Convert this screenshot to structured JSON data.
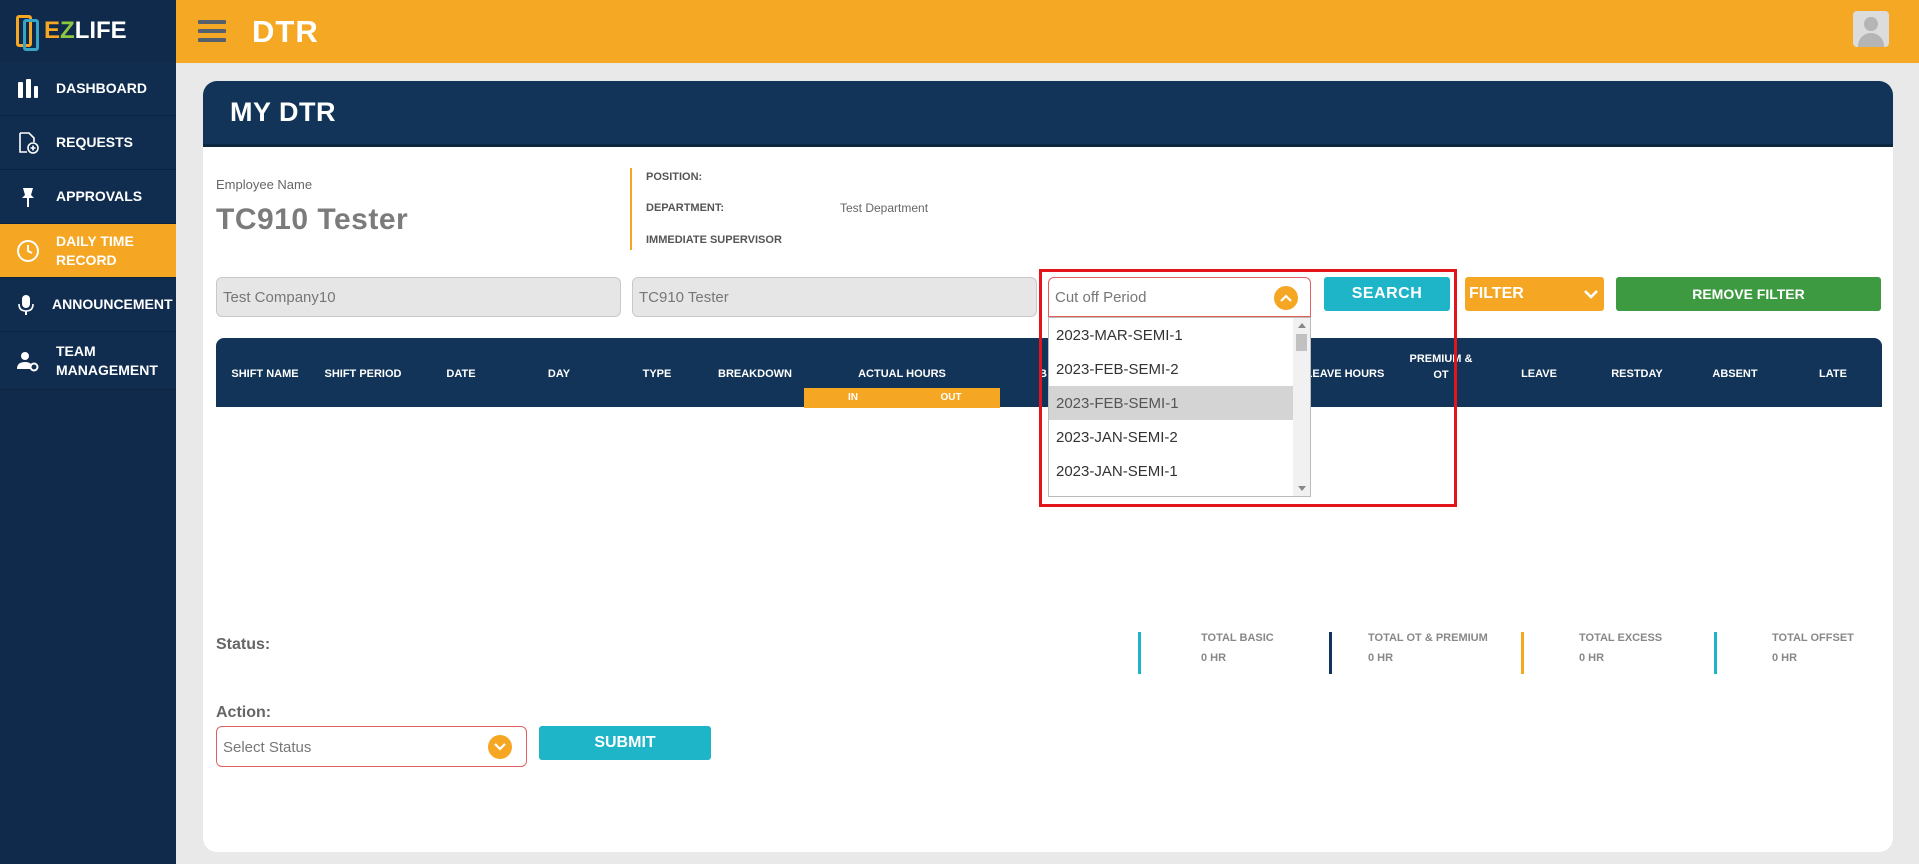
{
  "brand": {
    "logo_text_e": "E",
    "logo_text_z": "Z",
    "logo_text_rest": "LIFE"
  },
  "sidebar": {
    "items": [
      {
        "label": "DASHBOARD",
        "icon": "bar-chart-icon"
      },
      {
        "label": "REQUESTS",
        "icon": "document-add-icon"
      },
      {
        "label": "APPROVALS",
        "icon": "pin-icon"
      },
      {
        "label": "DAILY TIME RECORD",
        "icon": "clock-icon",
        "active": true
      },
      {
        "label": "ANNOUNCEMENT",
        "icon": "microphone-icon"
      },
      {
        "label": "TEAM MANAGEMENT",
        "icon": "user-gear-icon"
      }
    ]
  },
  "topbar": {
    "title": "DTR"
  },
  "page": {
    "title": "MY DTR",
    "employee_label": "Employee Name",
    "employee_name": "TC910 Tester",
    "position_label": "POSITION:",
    "position_value": "",
    "department_label": "DEPARTMENT:",
    "department_value": "Test Department",
    "supervisor_label": "IMMEDIATE SUPERVISOR",
    "supervisor_value": ""
  },
  "filters": {
    "company": "Test Company10",
    "employee": "TC910 Tester",
    "cutoff_placeholder": "Cut off Period",
    "cutoff_options": [
      "2023-MAR-SEMI-1",
      "2023-FEB-SEMI-2",
      "2023-FEB-SEMI-1",
      "2023-JAN-SEMI-2",
      "2023-JAN-SEMI-1"
    ],
    "cutoff_highlighted": "2023-FEB-SEMI-1",
    "search_label": "SEARCH",
    "filter_label": "FILTER",
    "remove_filter_label": "REMOVE FILTER"
  },
  "table": {
    "headers": {
      "shift_name": "SHIFT NAME",
      "shift_period": "SHIFT PERIOD",
      "date": "DATE",
      "day": "DAY",
      "type": "TYPE",
      "breakdown": "BREAKDOWN",
      "actual_hours": "ACTUAL HOURS",
      "in": "IN",
      "out": "OUT",
      "basic_partial": "B",
      "leave_hours": "LEAVE HOURS",
      "premium_ot_1": "PREMIUM &",
      "premium_ot_2": "OT",
      "leave": "LEAVE",
      "restday": "RESTDAY",
      "absent": "ABSENT",
      "late": "LATE"
    }
  },
  "summary": {
    "status_label": "Status:",
    "totals": [
      {
        "label": "TOTAL BASIC",
        "value": "0 HR",
        "color": "#1eb5c9"
      },
      {
        "label": "TOTAL OT & PREMIUM",
        "value": "0 HR",
        "color": "#123458"
      },
      {
        "label": "TOTAL EXCESS",
        "value": "0 HR",
        "color": "#f5a623"
      },
      {
        "label": "TOTAL OFFSET",
        "value": "0 HR",
        "color": "#1eb5c9"
      }
    ]
  },
  "action": {
    "label": "Action:",
    "select_placeholder": "Select Status",
    "submit_label": "SUBMIT"
  },
  "colors": {
    "navy": "#123458",
    "orange": "#f5a623",
    "teal": "#1eb5c9",
    "green": "#3d9a40",
    "highlight_red": "#e4141c"
  }
}
